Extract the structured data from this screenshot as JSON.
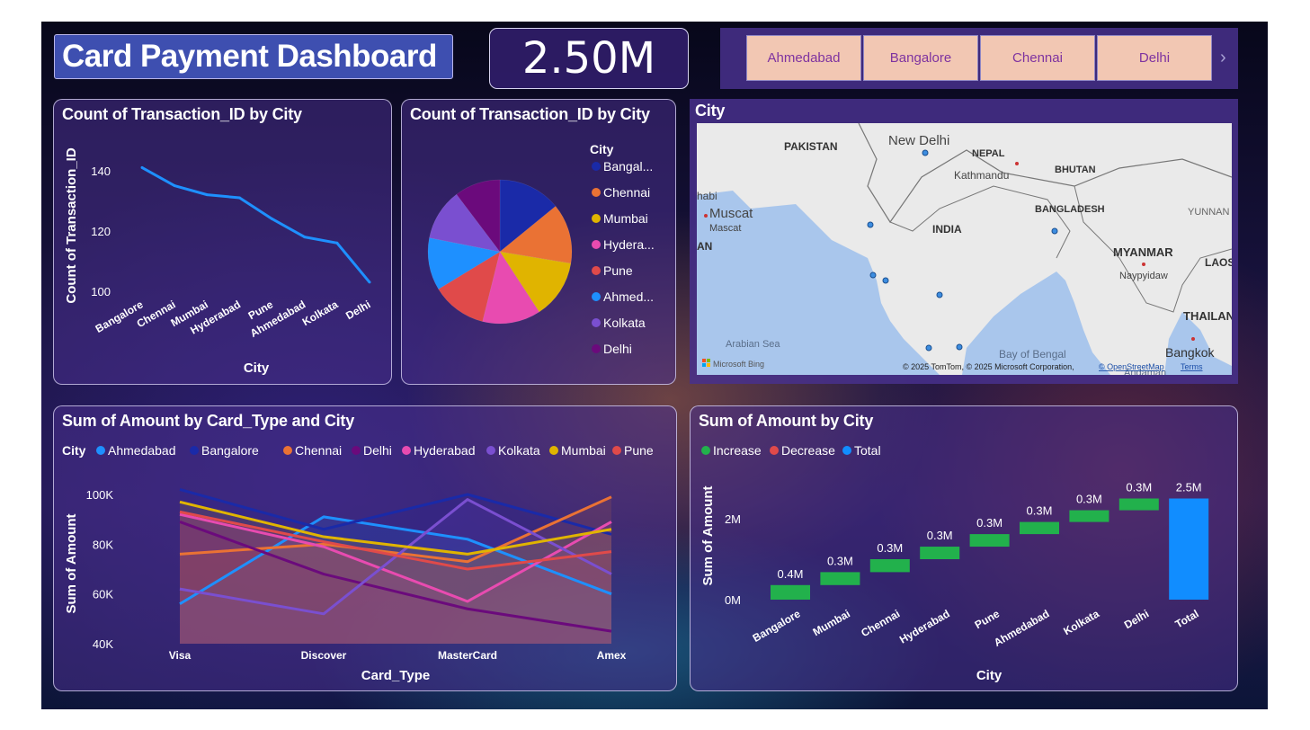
{
  "header": {
    "title": "Card Payment Dashboard",
    "kpi_value": "2.50M"
  },
  "slicer": {
    "items": [
      "Ahmedabad",
      "Bangalore",
      "Chennai",
      "Delhi"
    ],
    "next_icon": "chevron-right-icon"
  },
  "map": {
    "title": "City",
    "labels": {
      "pakistan": "PAKISTAN",
      "new_delhi": "New Delhi",
      "nepal": "NEPAL",
      "kathmandu": "Kathmandu",
      "bhutan": "BHUTAN",
      "dhabi": "habi",
      "muscat": "Muscat",
      "muscat2": "Mascat",
      "an": "AN",
      "india": "INDIA",
      "bangladesh": "BANGLADESH",
      "yunnan": "YUNNAN",
      "myanmar": "MYANMAR",
      "naypyidaw": "Naypyidaw",
      "laos": "LAOS",
      "thailand": "THAILAN",
      "arabian_sea": "Arabian Sea",
      "bay_of_bengal": "Bay of Bengal",
      "bangkok": "Bangkok",
      "andaman": "Andaman",
      "bing": "Microsoft Bing",
      "copyright": "© 2025 TomTom, © 2025 Microsoft Corporation,",
      "osm": "© OpenStreetMap",
      "terms": "Terms"
    }
  },
  "colors": {
    "Ahmedabad": "#1e90ff",
    "Bangalore": "#1a2aa8",
    "Chennai": "#ea7234",
    "Delhi": "#6b0a7c",
    "Hyderabad": "#e84bb0",
    "Kolkata": "#7a4fd0",
    "Mumbai": "#e0b400",
    "Pune": "#e04a4a",
    "increase": "#22b14c",
    "decrease": "#e04a4a",
    "total": "#118dff",
    "line": "#1e90ff"
  },
  "chart_data": [
    {
      "id": "line",
      "type": "line",
      "title": "Count of Transaction_ID by City",
      "xlabel": "City",
      "ylabel": "Count of Transaction_ID",
      "categories": [
        "Bangalore",
        "Chennai",
        "Mumbai",
        "Hyderabad",
        "Pune",
        "Ahmedabad",
        "Kolkata",
        "Delhi"
      ],
      "values": [
        141,
        135,
        132,
        131,
        124,
        118,
        116,
        103
      ],
      "yticks": [
        "100",
        "120",
        "140"
      ],
      "ylim": [
        100,
        145
      ]
    },
    {
      "id": "pie",
      "type": "pie",
      "title": "Count of Transaction_ID by City",
      "legend_title": "City",
      "legend_labels": [
        "Bangal...",
        "Chennai",
        "Mumbai",
        "Hydera...",
        "Pune",
        "Ahmed...",
        "Kolkata",
        "Delhi"
      ],
      "series_keys": [
        "Bangalore",
        "Chennai",
        "Mumbai",
        "Hyderabad",
        "Pune",
        "Ahmedabad",
        "Kolkata",
        "Delhi"
      ],
      "values": [
        141,
        135,
        132,
        131,
        124,
        118,
        116,
        103
      ]
    },
    {
      "id": "area",
      "type": "area",
      "title": "Sum of Amount by Card_Type and City",
      "legend_title": "City",
      "xlabel": "Card_Type",
      "ylabel": "Sum of Amount",
      "categories": [
        "Visa",
        "Discover",
        "MasterCard",
        "Amex"
      ],
      "yticks": [
        "40K",
        "60K",
        "80K",
        "100K"
      ],
      "ylim": [
        40000,
        100000
      ],
      "series": [
        {
          "name": "Ahmedabad",
          "values": [
            56000,
            91000,
            82000,
            60000
          ]
        },
        {
          "name": "Bangalore",
          "values": [
            102000,
            86000,
            100000,
            84000
          ]
        },
        {
          "name": "Chennai",
          "values": [
            76000,
            80000,
            73000,
            99000
          ]
        },
        {
          "name": "Delhi",
          "values": [
            89000,
            68000,
            54000,
            45000
          ]
        },
        {
          "name": "Hyderabad",
          "values": [
            92000,
            79000,
            57000,
            89000
          ]
        },
        {
          "name": "Kolkata",
          "values": [
            62000,
            52000,
            98000,
            68000
          ]
        },
        {
          "name": "Mumbai",
          "values": [
            97000,
            83000,
            76000,
            86000
          ]
        },
        {
          "name": "Pune",
          "values": [
            93000,
            81000,
            70000,
            77000
          ]
        }
      ]
    },
    {
      "id": "waterfall",
      "type": "bar",
      "title": "Sum of Amount by City",
      "xlabel": "City",
      "ylabel": "Sum of Amount",
      "legend": [
        "Increase",
        "Decrease",
        "Total"
      ],
      "categories": [
        "Bangalore",
        "Mumbai",
        "Chennai",
        "Hyderabad",
        "Pune",
        "Ahmedabad",
        "Kolkata",
        "Delhi",
        "Total"
      ],
      "values": [
        0.36,
        0.32,
        0.32,
        0.31,
        0.31,
        0.3,
        0.29,
        0.29,
        2.5
      ],
      "data_labels": [
        "0.4M",
        "0.3M",
        "0.3M",
        "0.3M",
        "0.3M",
        "0.3M",
        "0.3M",
        "0.3M",
        "2.5M"
      ],
      "yticks": [
        "0M",
        "2M"
      ],
      "ylim": [
        0,
        2.6
      ]
    }
  ]
}
